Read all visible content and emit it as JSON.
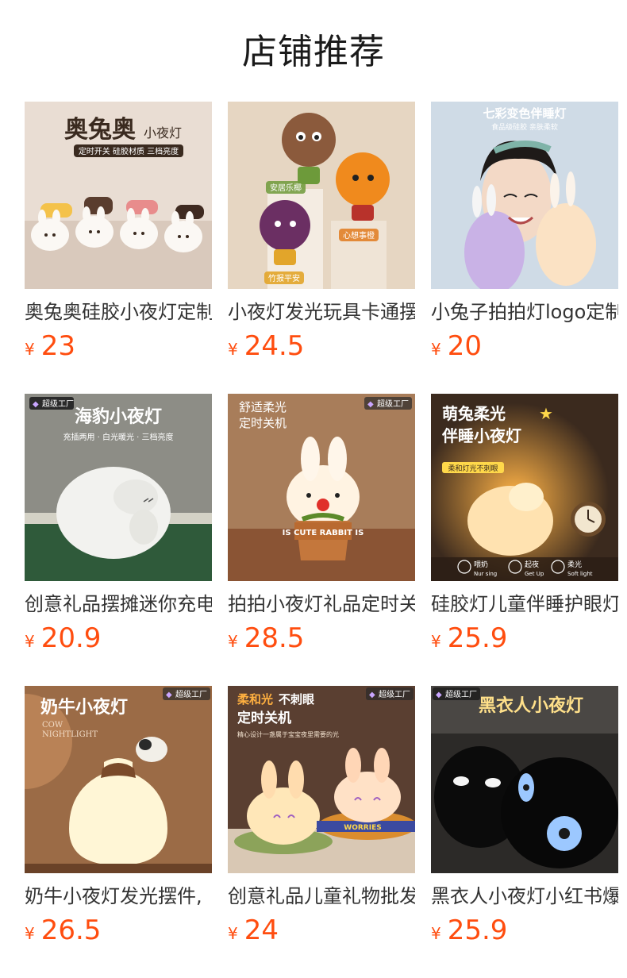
{
  "page": {
    "title": "店铺推荐"
  },
  "products": [
    {
      "name": "奥兔奥硅胶小夜灯定制",
      "currency": "¥",
      "price": "23",
      "image_text": {
        "brand": "奥兔奥",
        "sub": "小夜灯",
        "tags": "定时开关 硅胶材质 三档亮度"
      }
    },
    {
      "name": "小夜灯发光玩具卡通摆件",
      "currency": "¥",
      "price": "24.5",
      "image_text": {
        "tag1": "安居乐椰",
        "tag2": "心想事橙",
        "tag3": "竹报平安"
      }
    },
    {
      "name": "小兔子拍拍灯logo定制",
      "currency": "¥",
      "price": "20",
      "image_text": {
        "headline": "七彩变色伴睡灯",
        "sub": "食品级硅胶  亲肤柔软"
      }
    },
    {
      "name": "创意礼品摆摊迷你充电",
      "currency": "¥",
      "price": "20.9",
      "image_text": {
        "badge": "超级工厂",
        "headline": "海豹小夜灯",
        "sub": "充插两用 · 白光暖光 · 三档亮度"
      }
    },
    {
      "name": "拍拍小夜灯礼品定时关机",
      "currency": "¥",
      "price": "28.5",
      "image_text": {
        "badge": "超级工厂",
        "line1": "舒适柔光",
        "line2": "定时关机",
        "pot": "IS CUTE RABBIT IS"
      }
    },
    {
      "name": "硅胶灯儿童伴睡护眼灯",
      "currency": "¥",
      "price": "25.9",
      "image_text": {
        "line1": "萌兔柔光",
        "line2": "伴睡小夜灯",
        "tag": "柔和灯光不刺眼",
        "f1": "喂奶",
        "f1en": "Nur sing",
        "f2": "起夜",
        "f2en": "Get Up",
        "f3": "柔光",
        "f3en": "Soft light"
      }
    },
    {
      "name": "奶牛小夜灯发光摆件,",
      "currency": "¥",
      "price": "26.5",
      "image_text": {
        "badge": "超级工厂",
        "headline": "奶牛小夜灯",
        "en1": "COW",
        "en2": "NIGHTLIGHT"
      }
    },
    {
      "name": "创意礼品儿童礼物批发",
      "currency": "¥",
      "price": "24",
      "image_text": {
        "badge": "超级工厂",
        "line1a": "柔和光",
        "line1b": "不刺眼",
        "line2": "定时关机",
        "sub": "精心设计一盏属于宝宝夜里需要的光",
        "band": "WORRIES"
      }
    },
    {
      "name": "黑衣人小夜灯小红书爆款",
      "currency": "¥",
      "price": "25.9",
      "image_text": {
        "badge": "超级工厂",
        "headline": "黑衣人小夜灯"
      }
    }
  ],
  "colors": {
    "price": "#ff4d0f",
    "title": "#1a1a1a",
    "name": "#333333"
  }
}
